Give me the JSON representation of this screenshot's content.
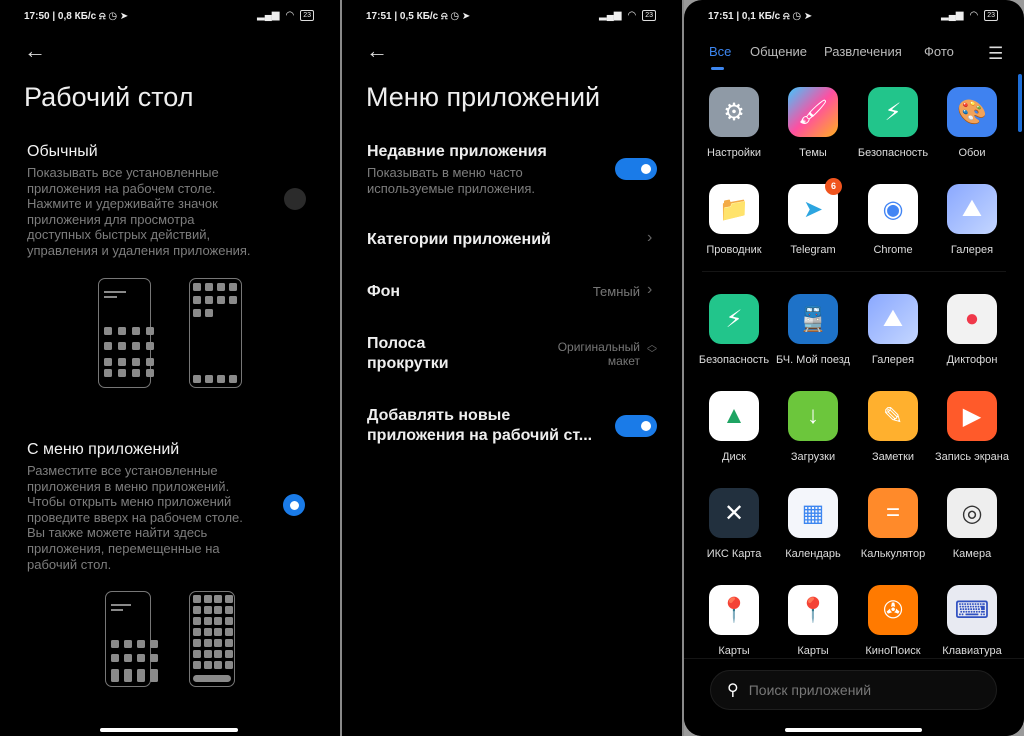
{
  "screen1": {
    "status": "17:50 | 0,8 КБ/с ⍾ ◷ ➤",
    "battery": "23",
    "title": "Рабочий стол",
    "option1": {
      "title": "Обычный",
      "desc": "Показывать все установленные приложения на рабочем столе. Нажмите и удерживайте значок приложения для просмотра доступных быстрых действий, управления и удаления приложения.",
      "selected": false
    },
    "option2": {
      "title": "С меню приложений",
      "desc": "Разместите все установленные приложения в меню приложений. Чтобы открыть меню приложений проведите вверх на рабочем столе. Вы также можете найти здесь приложения, перемещенные на рабочий стол.",
      "selected": true
    }
  },
  "screen2": {
    "status": "17:51 | 0,5 КБ/с ⍾ ◷ ➤",
    "battery": "23",
    "title": "Меню приложений",
    "recent": {
      "title": "Недавние приложения",
      "desc": "Показывать в меню часто используемые приложения.",
      "on": true
    },
    "categories": {
      "title": "Категории приложений"
    },
    "background": {
      "title": "Фон",
      "value": "Темный"
    },
    "scrollbar": {
      "title1": "Полоса",
      "title2": "прокрутки",
      "value1": "Оригинальный",
      "value2": "макет"
    },
    "add_new": {
      "title1": "Добавлять новые",
      "title2": "приложения на рабочий ст...",
      "on": true
    }
  },
  "screen3": {
    "status": "17:51 | 0,1 КБ/с ⍾ ◷ ➤",
    "battery": "23",
    "tabs": [
      "Все",
      "Общение",
      "Развлечения",
      "Фото"
    ],
    "active_tab": "Все",
    "accent": "#3d86f0",
    "recent_apps": [
      {
        "name": "Настройки",
        "icon": "gear-icon",
        "bg": "#8f9aa6",
        "glyph": "⚙"
      },
      {
        "name": "Темы",
        "icon": "brush-icon",
        "bg": "linear-gradient(135deg,#3fc7ff,#ff4fa0,#ffb020)",
        "glyph": "🖌"
      },
      {
        "name": "Безопасность",
        "icon": "shield-icon",
        "bg": "#22c58b",
        "glyph": "⚡"
      },
      {
        "name": "Обои",
        "icon": "palette-icon",
        "bg": "#3f82f0",
        "glyph": "🎨"
      },
      {
        "name": "Проводник",
        "icon": "folder-icon",
        "bg": "#fff",
        "glyph": "📁"
      },
      {
        "name": "Telegram",
        "icon": "telegram-icon",
        "bg": "#fff",
        "glyph": "➤",
        "fg": "#2ca5e0",
        "badge": "6"
      },
      {
        "name": "Chrome",
        "icon": "chrome-icon",
        "bg": "#fff",
        "glyph": "◉",
        "fg": "#4285f4"
      },
      {
        "name": "Галерея",
        "icon": "gallery-icon",
        "bg": "linear-gradient(135deg,#8aa8ff,#c4d6ff)",
        "glyph": "⛰"
      }
    ],
    "apps": [
      {
        "name": "Безопасность",
        "icon": "shield-icon",
        "bg": "#22c58b",
        "glyph": "⚡"
      },
      {
        "name": "БЧ. Мой поезд",
        "icon": "train-icon",
        "bg": "#1e72c8",
        "glyph": "🚆"
      },
      {
        "name": "Галерея",
        "icon": "gallery-icon",
        "bg": "linear-gradient(135deg,#8aa8ff,#c4d6ff)",
        "glyph": "⛰"
      },
      {
        "name": "Диктофон",
        "icon": "record-icon",
        "bg": "#f2f2f2",
        "glyph": "●",
        "fg": "#f0384a"
      },
      {
        "name": "Диск",
        "icon": "drive-icon",
        "bg": "#fff",
        "glyph": "▲",
        "fg": "#1fa463"
      },
      {
        "name": "Загрузки",
        "icon": "download-icon",
        "bg": "#6cc63c",
        "glyph": "↓"
      },
      {
        "name": "Заметки",
        "icon": "pencil-icon",
        "bg": "#ffb02e",
        "glyph": "✎"
      },
      {
        "name": "Запись экрана",
        "icon": "video-icon",
        "bg": "#ff5a2a",
        "glyph": "▶"
      },
      {
        "name": "ИКС Карта",
        "icon": "envelope-icon",
        "bg": "#22303e",
        "glyph": "✕"
      },
      {
        "name": "Календарь",
        "icon": "calendar-icon",
        "bg": "#f4f6fb",
        "glyph": "▦",
        "fg": "#3d86f0"
      },
      {
        "name": "Калькулятор",
        "icon": "calculator-icon",
        "bg": "#ff8a2a",
        "glyph": "="
      },
      {
        "name": "Камера",
        "icon": "camera-icon",
        "bg": "#eee",
        "glyph": "◎",
        "fg": "#333"
      },
      {
        "name": "Карты",
        "icon": "google-maps-icon",
        "bg": "#fff",
        "glyph": "📍"
      },
      {
        "name": "Карты",
        "icon": "yandex-maps-icon",
        "bg": "#fff",
        "glyph": "📍"
      },
      {
        "name": "КиноПоиск",
        "icon": "film-reel-icon",
        "bg": "#ff7a00",
        "glyph": "✇"
      },
      {
        "name": "Клавиатура Microsoft S...",
        "icon": "keyboard-icon",
        "bg": "#e8eaf2",
        "glyph": "⌨",
        "fg": "#3050c0"
      }
    ],
    "search_placeholder": "Поиск приложений"
  }
}
